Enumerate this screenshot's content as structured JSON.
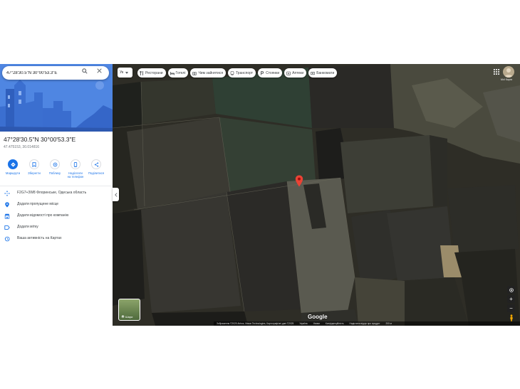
{
  "search": {
    "value": "47°28'30.5\"N 30°00'53.3\"E"
  },
  "place": {
    "title": "47°28'30.5\"N 30°00'53.3\"E",
    "decimal": "47.475153, 30.014816"
  },
  "actions": [
    {
      "label": "Маршрути",
      "icon": "directions-icon"
    },
    {
      "label": "Зберегти",
      "icon": "bookmark-icon"
    },
    {
      "label": "Поблизу",
      "icon": "nearby-icon"
    },
    {
      "label": "Надіслати на телефон",
      "label_l1": "Надіслати",
      "label_l2": "на телефон",
      "icon": "phone-icon"
    },
    {
      "label": "Поділитися",
      "icon": "share-icon"
    }
  ],
  "info_rows": [
    {
      "text": "F2G7+3W8 Флоринське, Одеська область",
      "icon": "plus-code-icon"
    },
    {
      "text": "Додати пропущене місце",
      "icon": "add-place-icon"
    },
    {
      "text": "Додати відомості про компанію",
      "icon": "business-icon"
    },
    {
      "text": "Додати мітку",
      "icon": "label-icon"
    },
    {
      "text": "Ваша активність на Картах",
      "icon": "history-icon"
    }
  ],
  "map": {
    "lang_button": "Ук",
    "chips": [
      {
        "label": "Ресторани",
        "icon": "restaurant-icon"
      },
      {
        "label": "Готелі",
        "icon": "hotel-icon"
      },
      {
        "label": "Чим зайнятися",
        "icon": "camera-icon"
      },
      {
        "label": "Транспорт",
        "icon": "transit-icon"
      },
      {
        "label": "Стоянки",
        "icon": "parking-icon"
      },
      {
        "label": "Аптеки",
        "icon": "pharmacy-icon"
      },
      {
        "label": "Банкомати",
        "icon": "atm-icon"
      }
    ],
    "layer_label": "Шари",
    "logo": "Google",
    "corner_label": "Мої Карти",
    "footer": [
      "Зображення ©2025 Airbus, Maxar Technologies, Картографічні дані ©2025",
      "Україна",
      "Умови",
      "Конфіденційність",
      "Надіслати відгук про продукт",
      "200 м"
    ]
  },
  "colors": {
    "accent": "#1a73e8",
    "pin": "#ea4335",
    "panel_hero": "#4a82e0"
  }
}
